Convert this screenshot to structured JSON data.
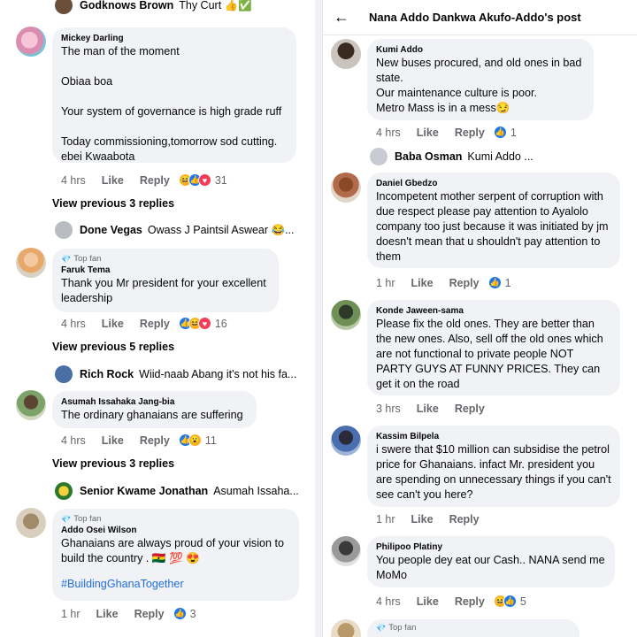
{
  "left": {
    "top_partial": {
      "name": "Godknows Brown",
      "text": "Thy Curt 👍✅"
    },
    "comments": [
      {
        "author": "Mickey Darling",
        "text": "The man of the moment\n\nObiaa boa\n\nYour system of governance is high grade ruff\n\nToday commissioning,tomorrow sod cutting.\nebei Kwaabota",
        "time": "4 hrs",
        "like": "Like",
        "reply": "Reply",
        "count": "31"
      },
      {
        "top_fan": "Top fan",
        "author": "Faruk Tema",
        "text": "Thank you Mr president for your excellent leadership",
        "time": "4 hrs",
        "like": "Like",
        "reply": "Reply",
        "count": "16"
      },
      {
        "author": "Asumah Issahaka Jang-bia",
        "text": "The ordinary ghanaians are suffering",
        "time": "4 hrs",
        "like": "Like",
        "reply": "Reply",
        "count": "11"
      },
      {
        "top_fan": "Top fan",
        "author": "Addo Osei Wilson",
        "text": "Ghanaians are always  proud of your vision to build the country . 🇬🇭 💯 😍",
        "hashtag": "#BuildingGhanaTogether",
        "time": "1 hr",
        "like": "Like",
        "reply": "Reply",
        "count": "3"
      }
    ],
    "view_previous": [
      "View previous 3 replies",
      "View previous 5 replies",
      "View previous 3 replies"
    ],
    "reply_previews": [
      {
        "name": "Done Vegas",
        "text": "Owass J Paintsil Aswear 😂..."
      },
      {
        "name": "Rich Rock",
        "text": "Wiid-naab Abang it's not his fa..."
      },
      {
        "name": "Senior Kwame Jonathan",
        "text": "Asumah Issaha..."
      }
    ]
  },
  "right": {
    "header": {
      "back_icon": "←",
      "title": "Nana Addo Dankwa Akufo-Addo's post"
    },
    "comments": [
      {
        "author": "Kumi Addo",
        "text": "New buses procured, and old ones in bad state.\nOur maintenance culture is poor.\nMetro Mass is in a mess😏",
        "time": "4 hrs",
        "like": "Like",
        "reply": "Reply",
        "count": "1"
      },
      {
        "author": "Daniel Gbedzo",
        "text": "Incompetent mother serpent of corruption with due respect please pay attention to Ayalolo company too just because it was initiated by jm doesn't mean that u shouldn't pay attention to them",
        "time": "1 hr",
        "like": "Like",
        "reply": "Reply",
        "count": "1"
      },
      {
        "author": "Konde Jaween-sama",
        "text": "Please fix the old ones. They are better than the new ones. Also, sell off the old ones which are not functional to private people NOT PARTY GUYS AT FUNNY PRICES. They can get it on the road",
        "time": "3 hrs",
        "like": "Like",
        "reply": "Reply",
        "count": ""
      },
      {
        "author": "Kassim Bilpela",
        "text": "i swere that $10 million can subsidise the petrol price for Ghanaians. infact Mr. president you are spending on unnecessary things if you can't see can't you here?",
        "time": "1 hr",
        "like": "Like",
        "reply": "Reply",
        "count": ""
      },
      {
        "author": "Philipoo Platiny",
        "text": "You people dey eat our Cash.. NANA send me MoMo",
        "time": "4 hrs",
        "like": "Like",
        "reply": "Reply",
        "count": "5"
      }
    ],
    "reply_preview": {
      "name": "Baba Osman",
      "text": "Kumi Addo ..."
    },
    "bottom_partial": {
      "top_fan": "Top fan"
    }
  },
  "colors": {
    "like_blue": "#1877f2",
    "love_red": "#f33e58",
    "haha_yellow": "#f7b125",
    "bubble": "#f0f2f5",
    "meta": "#65676b"
  }
}
